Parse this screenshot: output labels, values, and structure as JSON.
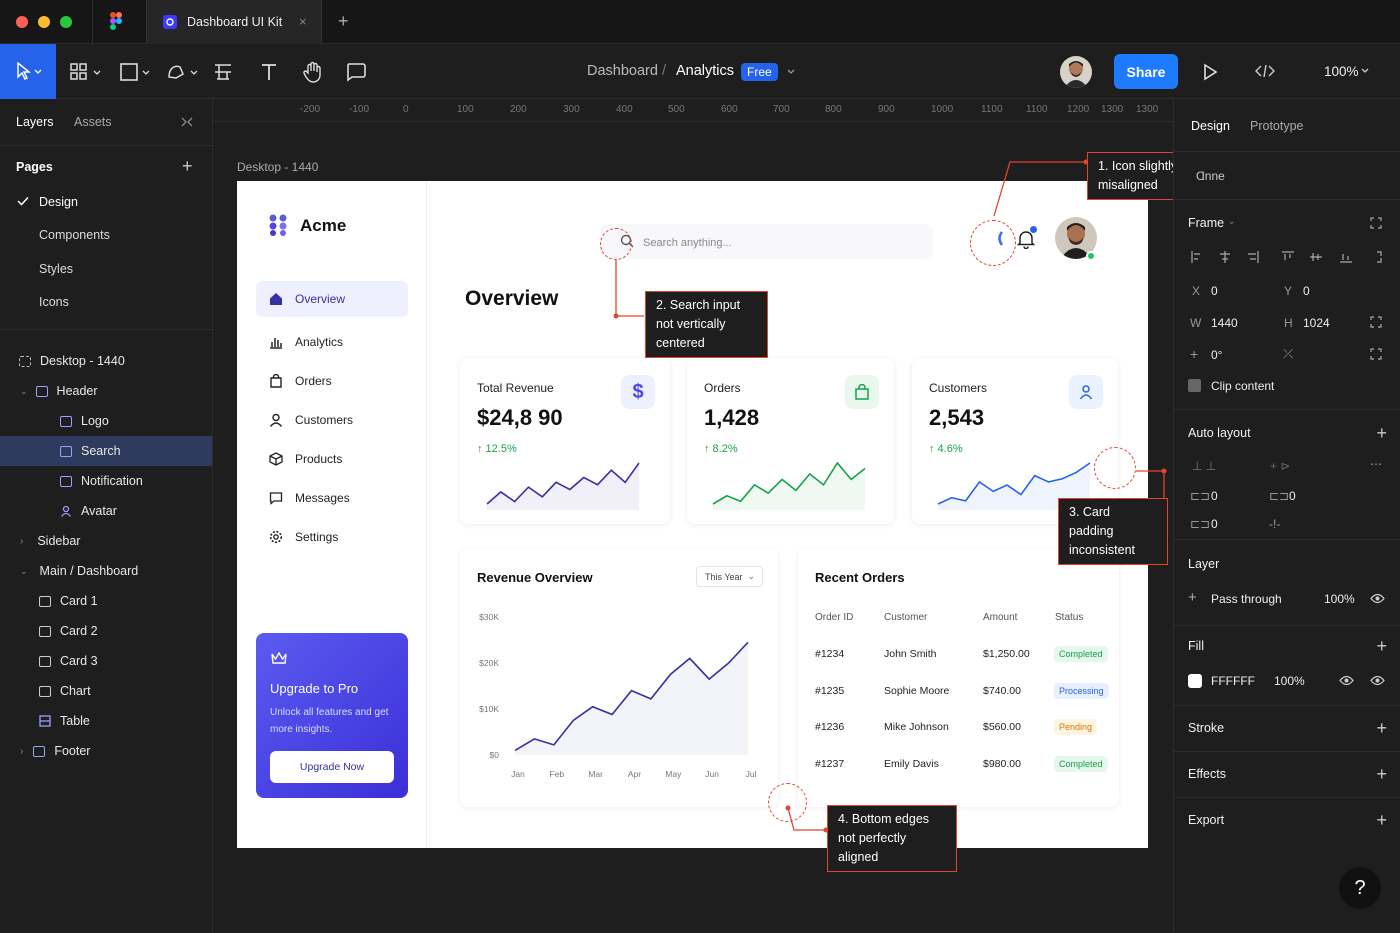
{
  "window": {
    "tab_title": "Dashboard UI Kit",
    "new_tab": "+",
    "tab_close": "×"
  },
  "toolbar": {
    "breadcrumb_root": "Dashboard",
    "breadcrumb_sep": "/",
    "breadcrumb_page": "Analytics",
    "plan_badge": "Free",
    "share_label": "Share",
    "zoom": "100%"
  },
  "left_panel": {
    "tabs": [
      "Layers",
      "Assets"
    ],
    "pages_title": "Pages",
    "pages": [
      "Design",
      "Components",
      "Styles",
      "Icons"
    ],
    "layers": [
      {
        "label": "Desktop - 1440",
        "indent": 0
      },
      {
        "label": "Header",
        "indent": 1
      },
      {
        "label": "Logo",
        "indent": 2
      },
      {
        "label": "Search",
        "indent": 2
      },
      {
        "label": "Notification",
        "indent": 2
      },
      {
        "label": "Avatar",
        "indent": 2
      },
      {
        "label": "Sidebar",
        "indent": 1
      },
      {
        "label": "Main / Dashboard",
        "indent": 1
      },
      {
        "label": "Card 1",
        "indent": 1
      },
      {
        "label": "Card 2",
        "indent": 1
      },
      {
        "label": "Card 3",
        "indent": 1
      },
      {
        "label": "Chart",
        "indent": 1
      },
      {
        "label": "Table",
        "indent": 1
      },
      {
        "label": "Footer",
        "indent": 1
      }
    ]
  },
  "ruler": {
    "ticks": [
      "-200",
      "-100",
      "0",
      "100",
      "200",
      "300",
      "400",
      "500",
      "600",
      "700",
      "800",
      "900",
      "1000",
      "1100",
      "1100",
      "1200",
      "1300",
      "1300"
    ]
  },
  "canvas": {
    "frame_label": "Desktop - 1440"
  },
  "app": {
    "brand": "Acme",
    "search_placeholder": "Search anything...",
    "page_title": "Overview",
    "nav": [
      "Overview",
      "Analytics",
      "Orders",
      "Customers",
      "Products",
      "Messages",
      "Settings"
    ],
    "upgrade": {
      "title": "Upgrade to Pro",
      "text": "Unlock all features and get more insights.",
      "button": "Upgrade Now"
    },
    "stats": [
      {
        "title": "Total Revenue",
        "value": "$24,8 90",
        "change": "↑ 12.5%",
        "icon": "dollar-icon",
        "color": "#4f46e5",
        "bg": "#eef0ff"
      },
      {
        "title": "Orders",
        "value": "1,428",
        "change": "↑ 8.2%",
        "icon": "bag-icon",
        "color": "#16a34a",
        "bg": "#e8f8ee"
      },
      {
        "title": "Customers",
        "value": "2,543",
        "change": "↑ 4.6%",
        "icon": "user-icon",
        "color": "#2563eb",
        "bg": "#eaf1ff"
      }
    ],
    "revenue": {
      "title": "Revenue Overview",
      "filter": "This Year"
    },
    "orders": {
      "title": "Recent Orders",
      "headers": [
        "Order ID",
        "Customer",
        "Amount",
        "Status"
      ],
      "rows": [
        {
          "id": "#1234",
          "customer": "John Smith",
          "amount": "$1,250.00",
          "status": "Completed",
          "fg": "#16a34a",
          "bg": "#e6f7ec"
        },
        {
          "id": "#1235",
          "customer": "Sophie Moore",
          "amount": "$740.00",
          "status": "Processing",
          "fg": "#2563eb",
          "bg": "#e8f0ff"
        },
        {
          "id": "#1236",
          "customer": "Mike Johnson",
          "amount": "$560.00",
          "status": "Pending",
          "fg": "#d97706",
          "bg": "#fff4e0"
        },
        {
          "id": "#1237",
          "customer": "Emily Davis",
          "amount": "$980.00",
          "status": "Completed",
          "fg": "#16a34a",
          "bg": "#e6f7ec"
        }
      ]
    }
  },
  "annotations": [
    "1. Icon slightly misaligned",
    "2. Search input not vertically centered",
    "3. Card padding inconsistent",
    "4. Bottom edges not perfectly aligned"
  ],
  "right_panel": {
    "tabs": [
      "Design",
      "Prototype"
    ],
    "top_label": "Ɑnne",
    "frame_label": "Frame",
    "x_label": "X",
    "x_value": "0",
    "y_label": "Y",
    "y_value": "0",
    "w_label": "W",
    "w_value": "1440",
    "h_label": "H",
    "h_value": "1024",
    "rotation": "0°",
    "clip_content": "Clip content",
    "auto_layout": "Auto layout",
    "auto_values": [
      "0",
      "0",
      "0"
    ],
    "layer_title": "Layer",
    "blend": "Pass through",
    "layer_opacity": "100%",
    "fill_title": "Fill",
    "fill_hex": "FFFFFF",
    "fill_opacity": "100%",
    "stroke": "Stroke",
    "effects": "Effects",
    "export": "Export",
    "help": "?"
  },
  "chart_data": [
    {
      "type": "line",
      "categories": [
        "Jan",
        "Feb",
        "Mar",
        "Apr",
        "May",
        "Jun",
        "Jul"
      ],
      "y_ticks": [
        "$30K",
        "$20K",
        "$10K",
        "$0"
      ],
      "ylim": [
        0,
        30000
      ],
      "x": [
        0,
        0.5,
        1,
        1.5,
        2,
        2.5,
        3,
        3.5,
        4,
        4.5,
        5,
        5.5,
        6
      ],
      "values": [
        1000,
        3500,
        2200,
        7500,
        10500,
        8800,
        14000,
        12200,
        17500,
        21000,
        16500,
        20000,
        24500
      ],
      "color": "#3730a3"
    },
    {
      "type": "line",
      "name": "revenue-sparkline",
      "values": [
        3,
        8,
        4,
        10,
        6,
        12,
        9,
        14,
        11,
        17,
        12,
        20
      ],
      "color": "#3730a3"
    },
    {
      "type": "line",
      "name": "orders-sparkline",
      "values": [
        3,
        6,
        4,
        10,
        7,
        12,
        8,
        14,
        10,
        18,
        12,
        16
      ],
      "color": "#16a34a"
    },
    {
      "type": "line",
      "name": "customers-sparkline",
      "values": [
        3,
        5,
        4,
        10,
        7,
        9,
        6,
        12,
        10,
        11,
        13,
        16
      ],
      "color": "#2563eb"
    }
  ]
}
